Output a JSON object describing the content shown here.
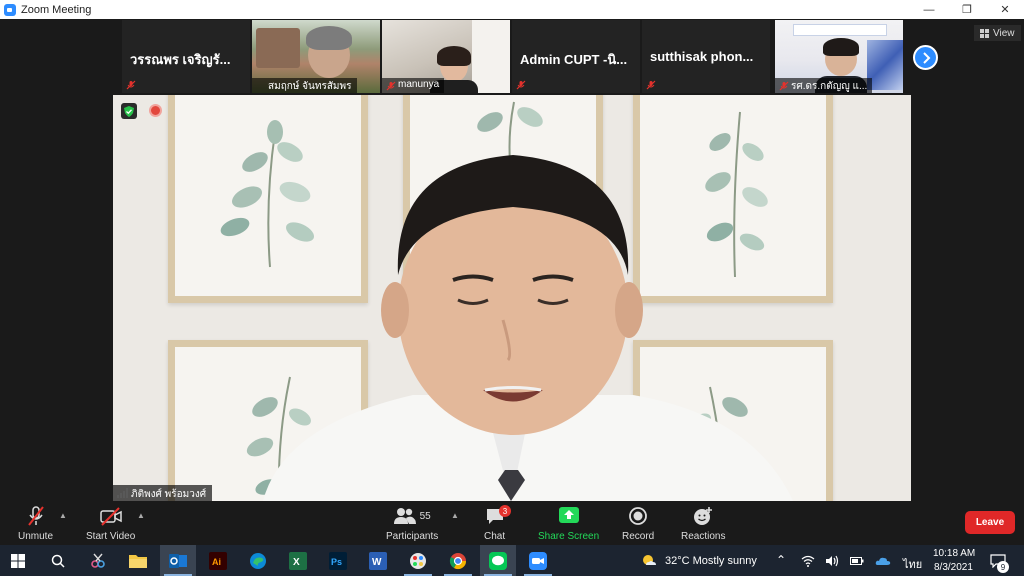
{
  "window": {
    "title": "Zoom Meeting",
    "controls": {
      "minimize": "—",
      "restore": "❐",
      "close": "✕"
    }
  },
  "participants_strip": {
    "tiles": [
      {
        "name": "วรรณพร เจริญรั...",
        "video": false,
        "muted": true
      },
      {
        "name": "สมฤกษ์ จันทรสัมพร",
        "video": true,
        "muted": false
      },
      {
        "name": "manunya",
        "video": true,
        "muted": true
      },
      {
        "name": "Admin CUPT -นิ...",
        "video": false,
        "muted": true
      },
      {
        "name": "sutthisak phon...",
        "video": false,
        "muted": true
      },
      {
        "name": "รศ.ดร.กตัญญู แ...",
        "video": true,
        "muted": true
      }
    ],
    "next_page_icon": "chevron-right-icon",
    "view_button": "View"
  },
  "main_video": {
    "speaker_name": "ภิติพงศ์ พร้อมวงศ์"
  },
  "toolbar": {
    "unmute": "Unmute",
    "start_video": "Start Video",
    "participants": "Participants",
    "participants_count": "55",
    "chat": "Chat",
    "chat_badge": "3",
    "share_screen": "Share Screen",
    "record": "Record",
    "reactions": "Reactions",
    "leave": "Leave"
  },
  "taskbar": {
    "weather": "32°C  Mostly sunny",
    "language": "ไทย",
    "time": "10:18 AM",
    "date": "8/3/2021",
    "notification_count": "9"
  },
  "colors": {
    "zoom_blue": "#2d8cff",
    "leave_red": "#e02828",
    "share_green": "#23d959",
    "taskbar_bg": "#1c2430"
  }
}
